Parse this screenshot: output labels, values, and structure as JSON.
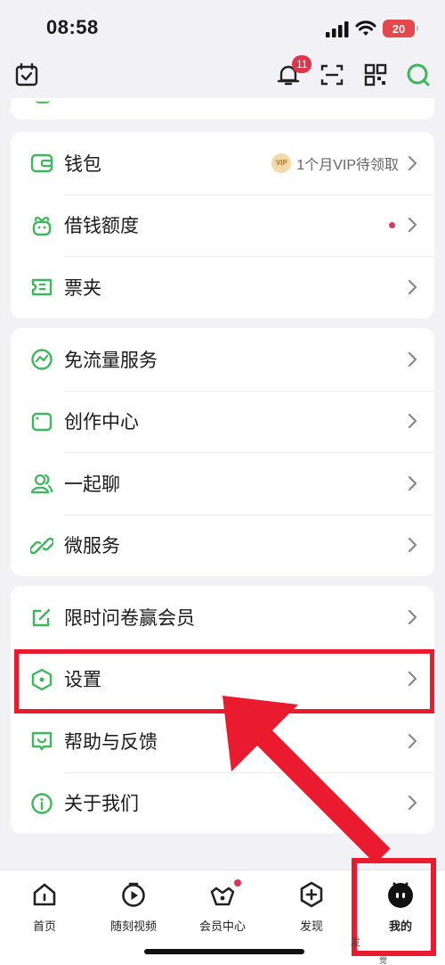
{
  "status_bar": {
    "time": "08:58",
    "battery": "20"
  },
  "header": {
    "notification_count": "11"
  },
  "groups": [
    {
      "items": [
        {
          "label": "钱包",
          "icon": "wallet-icon",
          "right_text": "1个月VIP待领取",
          "vip_badge": "VIP"
        },
        {
          "label": "借钱额度",
          "icon": "loan-icon",
          "dot": true
        },
        {
          "label": "票夹",
          "icon": "ticket-icon"
        }
      ]
    },
    {
      "items": [
        {
          "label": "免流量服务",
          "icon": "data-free-icon"
        },
        {
          "label": "创作中心",
          "icon": "creation-icon"
        },
        {
          "label": "一起聊",
          "icon": "chat-together-icon"
        },
        {
          "label": "微服务",
          "icon": "micro-service-icon"
        }
      ]
    },
    {
      "items": [
        {
          "label": "限时问卷赢会员",
          "icon": "survey-icon"
        },
        {
          "label": "设置",
          "icon": "settings-icon"
        },
        {
          "label": "帮助与反馈",
          "icon": "help-feedback-icon"
        },
        {
          "label": "关于我们",
          "icon": "about-icon"
        }
      ]
    }
  ],
  "tabbar": [
    {
      "label": "首页",
      "icon": "home-icon"
    },
    {
      "label": "随刻视频",
      "icon": "video-icon"
    },
    {
      "label": "会员中心",
      "icon": "vip-crown-icon",
      "dot": true
    },
    {
      "label": "发现",
      "icon": "discover-icon"
    },
    {
      "label": "我的",
      "icon": "mine-icon"
    }
  ],
  "stray_text": {
    "a": "发",
    "b": "觉"
  },
  "colors": {
    "accent_green": "#3bb85a",
    "highlight_red": "#ea1a2f",
    "badge_red": "#e0344a"
  }
}
